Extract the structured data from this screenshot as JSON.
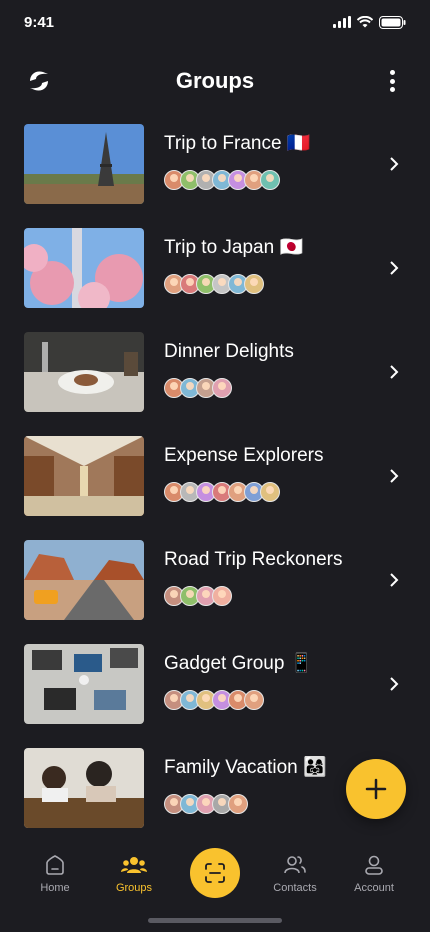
{
  "status_bar": {
    "time": "9:41"
  },
  "header": {
    "title": "Groups"
  },
  "groups": [
    {
      "name": "Trip to France 🇫🇷",
      "avatars": [
        "#d98b6a",
        "#8fbf6a",
        "#e6e6e6",
        "#7fb8d6",
        "#c58fe0",
        "#e0a07f",
        "#6fc0b0"
      ]
    },
    {
      "name": "Trip to Japan 🇯🇵",
      "avatars": [
        "#e0a07f",
        "#d97a7a",
        "#8fbf6a",
        "#c5c5c5",
        "#7fb8d6",
        "#e0c07f"
      ]
    },
    {
      "name": "Dinner Delights",
      "avatars": [
        "#d98b6a",
        "#7fb8d6",
        "#c5a08f",
        "#e0a0b0"
      ]
    },
    {
      "name": "Expense Explorers",
      "avatars": [
        "#d98b6a",
        "#e6e6e6",
        "#c58fe0",
        "#d97a7a",
        "#e0a07f",
        "#7f9fd6",
        "#e0c07f"
      ]
    },
    {
      "name": "Road Trip Reckoners",
      "avatars": [
        "#c58f7f",
        "#8fbf6a",
        "#e0a0b0",
        "#f0b0a0"
      ]
    },
    {
      "name": "Gadget Group 📱",
      "avatars": [
        "#c58f7f",
        "#7fb8d6",
        "#e0c07f",
        "#c58fe0",
        "#d98b6a",
        "#e0a07f"
      ]
    },
    {
      "name": "Family Vacation 👨‍👩‍👧",
      "avatars": [
        "#c58f7f",
        "#7fb8d6",
        "#e0a0b0",
        "#c5c5c5",
        "#e0a07f"
      ]
    }
  ],
  "bottom_nav": {
    "home": "Home",
    "groups": "Groups",
    "contacts": "Contacts",
    "account": "Account"
  },
  "colors": {
    "accent": "#f9c22e",
    "background": "#1c1c21",
    "muted": "#a9a9b0"
  },
  "icons": {
    "logo": "app-logo",
    "menu": "more-vertical-icon",
    "row": "chevron-right-icon",
    "fab": "plus-icon",
    "scan": "scan-icon"
  }
}
